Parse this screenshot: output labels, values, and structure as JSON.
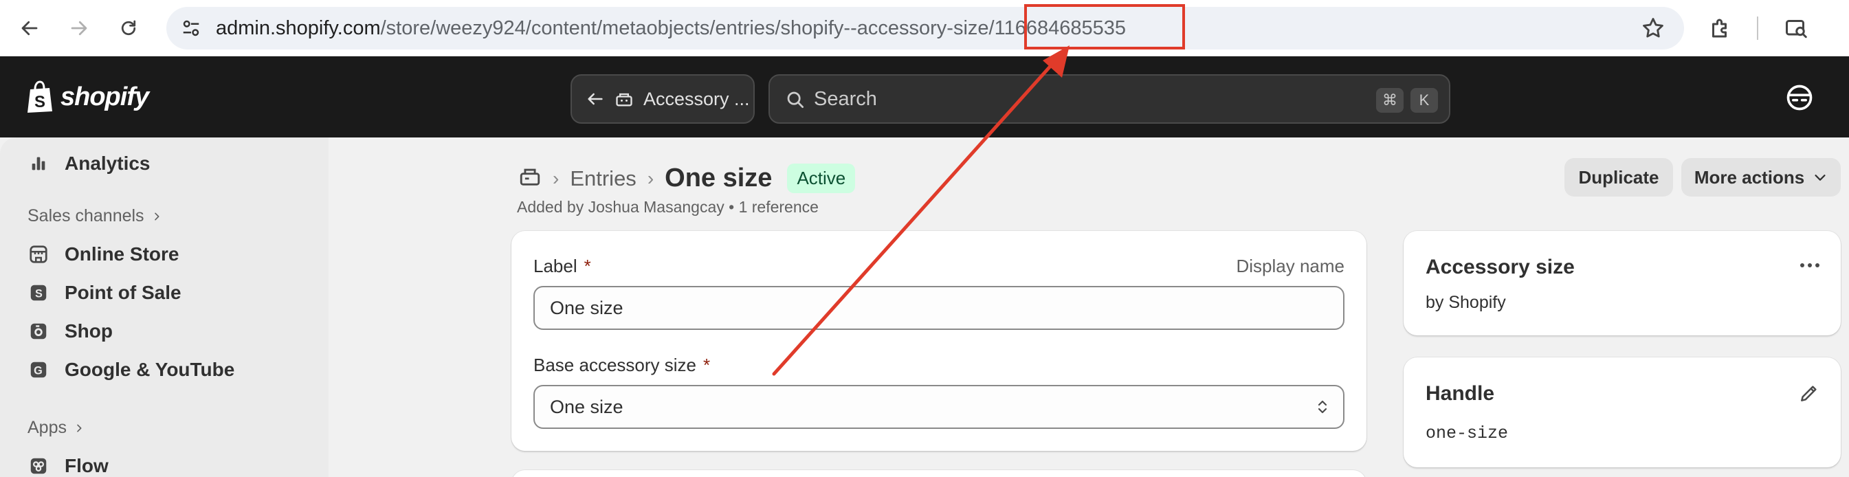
{
  "browser": {
    "url_host": "admin.shopify.com",
    "url_path": "/store/weezy924/content/metaobjects/entries/shopify--accessory-size",
    "url_id": "/116684685535"
  },
  "topbar": {
    "logo_text": "shopify",
    "back_label": "Accessory ...",
    "search_placeholder": "Search",
    "shortcut_cmd": "⌘",
    "shortcut_key": "K"
  },
  "sidebar": {
    "analytics": "Analytics",
    "sales_channels": "Sales channels",
    "online_store": "Online Store",
    "point_of_sale": "Point of Sale",
    "shop": "Shop",
    "google_youtube": "Google & YouTube",
    "apps": "Apps",
    "flow": "Flow"
  },
  "page": {
    "breadcrumb_entries": "Entries",
    "title": "One size",
    "status": "Active",
    "subtitle": "Added by Joshua Masangcay • 1 reference",
    "duplicate_label": "Duplicate",
    "more_actions_label": "More actions"
  },
  "form": {
    "label_field_label": "Label",
    "required_mark": "*",
    "display_name_hint": "Display name",
    "label_value": "One size",
    "base_size_label": "Base accessory size",
    "base_size_value": "One size"
  },
  "side_cards": {
    "definition_title": "Accessory size",
    "definition_by": "by Shopify",
    "handle_title": "Handle",
    "handle_value": "one-size"
  },
  "colors": {
    "annotation": "#e03b2a",
    "badge_bg": "#cdfee1",
    "badge_text": "#0c5132",
    "topbar": "#1a1a1a"
  }
}
